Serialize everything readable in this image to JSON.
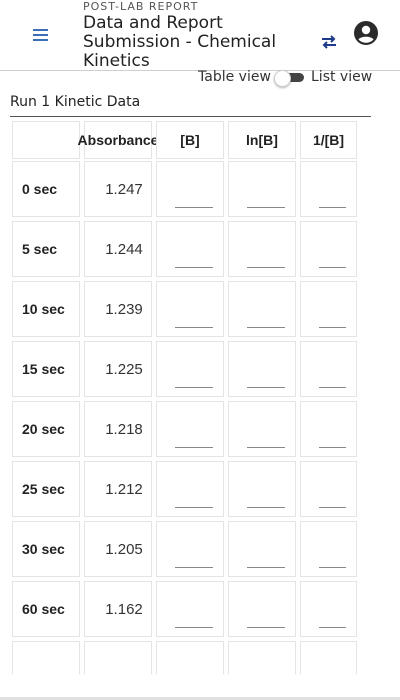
{
  "header": {
    "overline": "POST-LAB REPORT",
    "title": "Data and Report Submission - Chemical Kinetics",
    "menu_icon": "hamburger-menu-icon",
    "swap_icon": "swap-arrows-icon",
    "account_icon": "account-circle-icon"
  },
  "view_toggle": {
    "table_label": "Table view",
    "list_label": "List view"
  },
  "section": {
    "title": "Run 1 Kinetic Data"
  },
  "table": {
    "headers": [
      "Absorbance",
      "[B]",
      "ln[B]",
      "1/[B]"
    ],
    "rows": [
      {
        "label": "0 sec",
        "absorbance": "1.247"
      },
      {
        "label": "5 sec",
        "absorbance": "1.244"
      },
      {
        "label": "10 sec",
        "absorbance": "1.239"
      },
      {
        "label": "15 sec",
        "absorbance": "1.225"
      },
      {
        "label": "20 sec",
        "absorbance": "1.218"
      },
      {
        "label": "25 sec",
        "absorbance": "1.212"
      },
      {
        "label": "30 sec",
        "absorbance": "1.205"
      },
      {
        "label": "60 sec",
        "absorbance": "1.162"
      },
      {
        "label": "",
        "absorbance": ""
      }
    ]
  },
  "colors": {
    "menu_icon": "#3b6fb6",
    "swap_icon": "#1e3a8a",
    "toggle_track": "#444444",
    "cell_border": "#e4e4e4"
  }
}
